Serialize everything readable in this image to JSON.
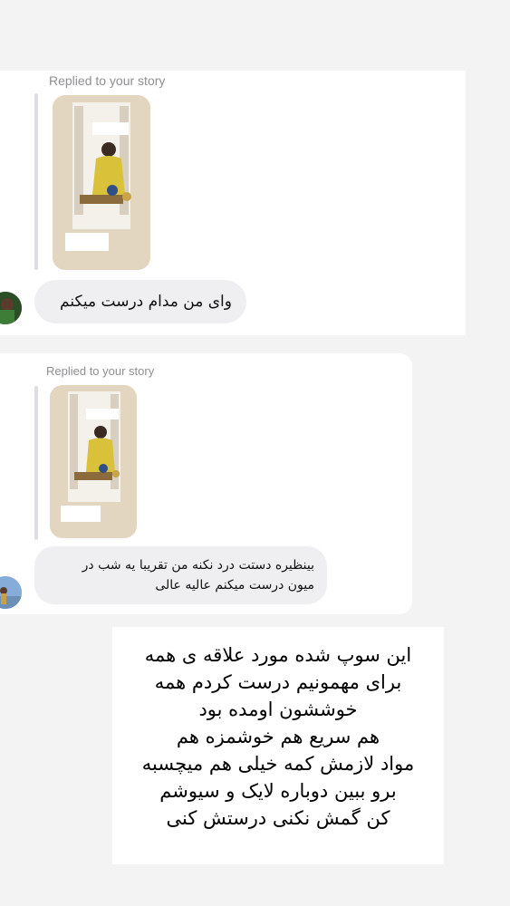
{
  "messages": [
    {
      "reply_label": "Replied to your story",
      "text": "وای من مدام درست میکنم",
      "thumbnail_icon": "story-thumbnail"
    },
    {
      "reply_label": "Replied to your story",
      "text_lines": [
        "بینظیره دستت درد نکنه من تقریبا یه شب در",
        "میون درست میکنم عالیه عالی"
      ],
      "thumbnail_icon": "story-thumbnail"
    }
  ],
  "note": {
    "lines": [
      "این سوپ شده مورد علاقه ی همه",
      "برای مهمونیم درست کردم همه",
      "خوششون اومده بود",
      "هم سریع هم خوشمزه هم",
      "مواد لازمش کمه خیلی هم میچسبه",
      "برو ببین دوباره لایک و سیوشم",
      "کن گمش نکنی درستش کنی"
    ]
  },
  "colors": {
    "background": "#f3f3f4",
    "bubble": "#efeff1",
    "label": "#8e8e93"
  }
}
